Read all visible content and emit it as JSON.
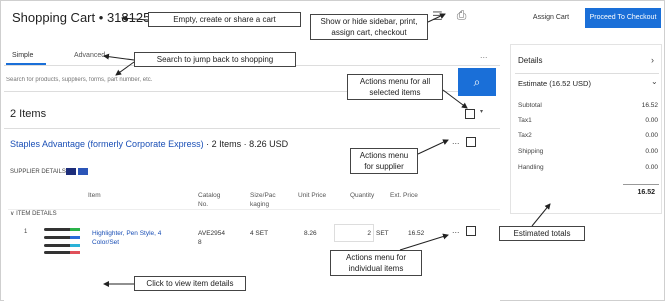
{
  "header": {
    "title": "Shopping Cart",
    "separator": "•",
    "cart_id": "3181250",
    "assign_cart_label": "Assign Cart",
    "checkout_label": "Proceed To Checkout"
  },
  "search": {
    "tabs": [
      "Simple",
      "Advanced"
    ],
    "more": "...",
    "placeholder": "Search for products, suppliers, forms, part number, etc."
  },
  "cart": {
    "items_count": "2 Items"
  },
  "supplier": {
    "name": "Staples Advantage (formerly Corporate Express)",
    "summary": "· 2 Items · 8.26 USD",
    "details_label": "SUPPLIER DETAILS",
    "more": "...",
    "columns": [
      "Item",
      "Catalog\nNo.",
      "Size/Pac\nkaging",
      "Unit Price",
      "Quantity",
      "Ext. Price"
    ]
  },
  "item": {
    "line_no": "1",
    "name": "Highlighter, Pen Style, 4 Color/Set",
    "catalog": "AVE2954\n8",
    "size": "4 SET",
    "unit_price": "8.26",
    "quantity": "2",
    "unit": "SET",
    "ext_price": "16.52",
    "more": "...",
    "details_label": "ITEM DETAILS"
  },
  "sidebar": {
    "details_label": "Details",
    "estimate_label": "Estimate (16.52 USD)",
    "rows": [
      {
        "label": "Subtotal",
        "value": "16.52"
      },
      {
        "label": "Tax1",
        "value": "0.00"
      },
      {
        "label": "Tax2",
        "value": "0.00"
      },
      {
        "label": "Shipping",
        "value": "0.00"
      },
      {
        "label": "Handling",
        "value": "0.00"
      }
    ],
    "total": "16.52"
  },
  "callouts": {
    "cart": "Empty, create or share a cart",
    "sidebar": "Show or hide sidebar, print,\nassign cart, checkout",
    "search": "Search to jump back to shopping",
    "actions_all": "Actions menu for all\nselected items",
    "actions_supplier": "Actions menu\nfor supplier",
    "actions_items": "Actions menu for\nindividual items",
    "estimated": "Estimated totals",
    "item_details": "Click to view item details"
  },
  "icons": {
    "sidebar_toggle": "hamburger-icon",
    "print": "printer-icon",
    "search": "search-icon"
  },
  "colors": {
    "accent": "#1a6fd8",
    "link": "#1a4fb6"
  }
}
